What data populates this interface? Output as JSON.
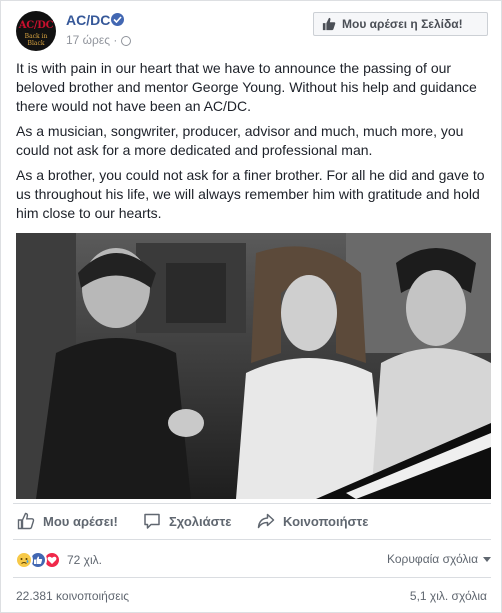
{
  "post": {
    "page_name": "AC/DC",
    "avatar_logo_top": "AC/DC",
    "avatar_logo_bottom": "Back in Black",
    "time": "17 ώρες · ",
    "like_page_label": "Μου αρέσει η Σελίδα!",
    "paragraphs": [
      "It is with pain in our heart that we have to announce the passing of our beloved brother and mentor George Young. Without his help and guidance there would not have been an AC/DC.",
      "As a musician, songwriter, producer, advisor and much, much more, you could not ask for a more dedicated and professional man.",
      "As a brother, you could not ask for a finer brother. For all he did and gave to us throughout his life, we will always remember him with gratitude and hold him close to our hearts."
    ],
    "photo_description": "black-and-white-photo-three-musicians-at-piano"
  },
  "actions": {
    "like_label": "Μου αρέσει!",
    "comment_label": "Σχολιάστε",
    "share_label": "Κοινοποιήστε"
  },
  "stats": {
    "reactions_count": "72 χιλ.",
    "top_comments_label": "Κορυφαία σχόλια",
    "shares_label": "22.381 κοινοποιήσεις",
    "comments_label": "5,1 χιλ. σχόλια"
  },
  "colors": {
    "link_blue": "#365899",
    "fb_blue": "#4267b2",
    "muted_gray": "#606770"
  }
}
